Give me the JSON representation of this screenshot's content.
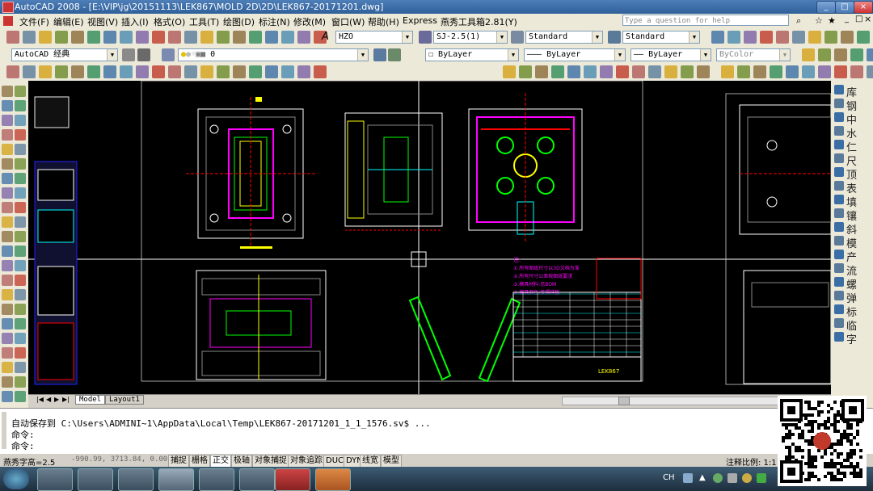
{
  "window": {
    "title": "AutoCAD 2008 - [E:\\VIP\\jg\\20151113\\LEK867\\MOLD 2D\\2D\\LEK867-20171201.dwg]"
  },
  "menu": [
    "文件(F)",
    "编辑(E)",
    "视图(V)",
    "插入(I)",
    "格式(O)",
    "工具(T)",
    "绘图(D)",
    "标注(N)",
    "修改(M)",
    "窗口(W)",
    "帮助(H)",
    "Express",
    "燕秀工具箱2.81(Y)"
  ],
  "help_placeholder": "Type a question for help",
  "toolbar": {
    "text_style": "HZO",
    "dim_style": "SJ-2.5(1)",
    "table_style": "Standard",
    "multileader_style": "Standard",
    "workspace": "AutoCAD 经典",
    "layer": "0",
    "color": "ByLayer",
    "linetype": "ByLayer",
    "lineweight": "ByLayer",
    "plotstyle": "ByColor"
  },
  "right_palette": [
    "库",
    "钢",
    "中",
    "水",
    "仁",
    "尺",
    "顶",
    "表",
    "填",
    "镶",
    "斜",
    "模",
    "产",
    "流",
    "螺",
    "弹",
    "标",
    "临",
    "字"
  ],
  "drawing": {
    "notes": [
      "注:",
      "①.所有图纸尺寸以3D文档为准",
      "②.所有尺寸公差按图纸要求",
      "③.模具材料:见BOM",
      "④.模具颜色:参照样板"
    ],
    "title_block": "LEK867"
  },
  "tabs": {
    "model": "Model",
    "layout": "Layout1"
  },
  "command": {
    "line1": "自动保存到 C:\\Users\\ADMINI~1\\AppData\\Local\\Temp\\LEK867-20171201_1_1_1576.sv$ ...",
    "line2": "命令:",
    "line3": "命令:"
  },
  "status": {
    "font_label": "燕秀字高=2.5",
    "coords": "-990.99, 3713.84, 0.00",
    "toggles": [
      "捕捉",
      "栅格",
      "正交",
      "极轴",
      "对象捕捉",
      "对象追踪",
      "DUCS",
      "DYN",
      "线宽",
      "模型"
    ],
    "scale_label": "注释比例: 1:1"
  },
  "taskbar": {
    "lang": "CH"
  },
  "colors": {
    "accent": "#2f5f9a",
    "canvas": "#000000"
  }
}
